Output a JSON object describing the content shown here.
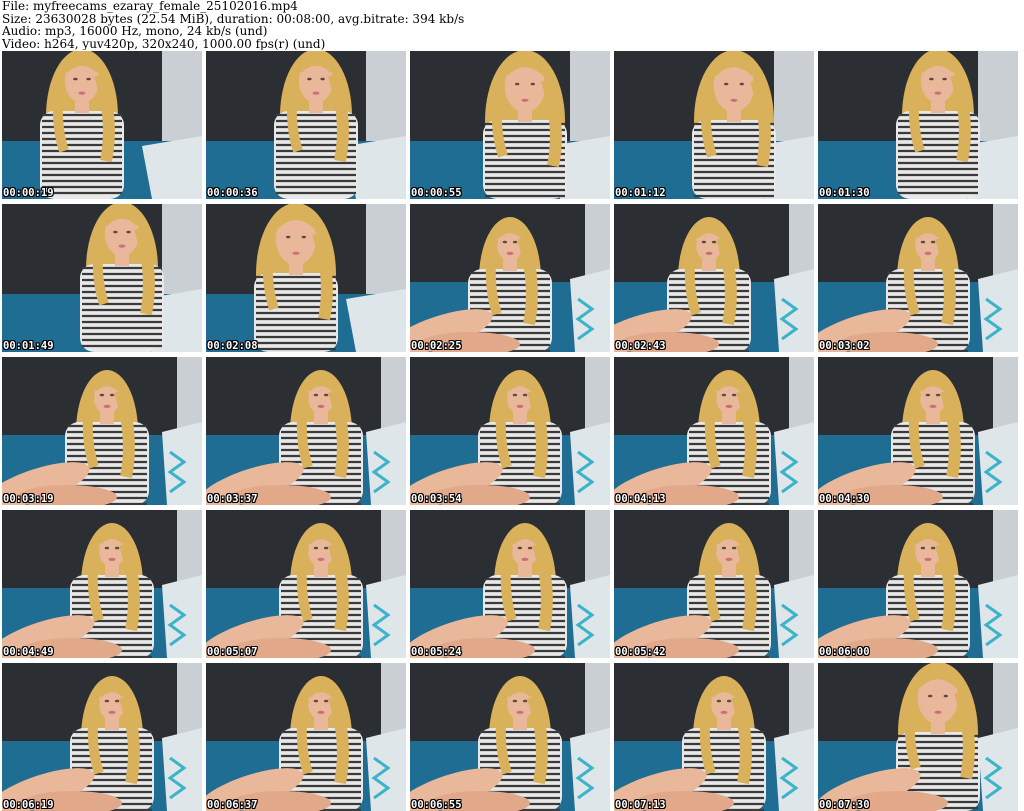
{
  "header": {
    "file_line": "File: myfreecams_ezaray_female_25102016.mp4",
    "size_line": "Size: 23630028 bytes (22.54 MiB), duration: 00:08:00, avg.bitrate: 394 kb/s",
    "audio_line": "Audio: mp3, 16000 Hz, mono, 24 kb/s (und)",
    "video_line": "Video: h264, yuv420p, 320x240, 1000.00 fps(r) (und)"
  },
  "thumbnails": [
    {
      "timestamp": "00:00:19"
    },
    {
      "timestamp": "00:00:36"
    },
    {
      "timestamp": "00:00:55"
    },
    {
      "timestamp": "00:01:12"
    },
    {
      "timestamp": "00:01:30"
    },
    {
      "timestamp": "00:01:49"
    },
    {
      "timestamp": "00:02:08"
    },
    {
      "timestamp": "00:02:25"
    },
    {
      "timestamp": "00:02:43"
    },
    {
      "timestamp": "00:03:02"
    },
    {
      "timestamp": "00:03:19"
    },
    {
      "timestamp": "00:03:37"
    },
    {
      "timestamp": "00:03:54"
    },
    {
      "timestamp": "00:04:13"
    },
    {
      "timestamp": "00:04:30"
    },
    {
      "timestamp": "00:04:49"
    },
    {
      "timestamp": "00:05:07"
    },
    {
      "timestamp": "00:05:24"
    },
    {
      "timestamp": "00:05:42"
    },
    {
      "timestamp": "00:06:00"
    },
    {
      "timestamp": "00:06:19"
    },
    {
      "timestamp": "00:06:37"
    },
    {
      "timestamp": "00:06:55"
    },
    {
      "timestamp": "00:07:13"
    },
    {
      "timestamp": "00:07:30"
    }
  ],
  "colors": {
    "wall": "#2b2e33",
    "sofa": "#1f6d92",
    "pillow": "#dfe6ea",
    "skin": "#e9b79a",
    "hair": "#d9b15a",
    "shirt": "#e8e8e8",
    "stripe": "#3a3a3a"
  }
}
